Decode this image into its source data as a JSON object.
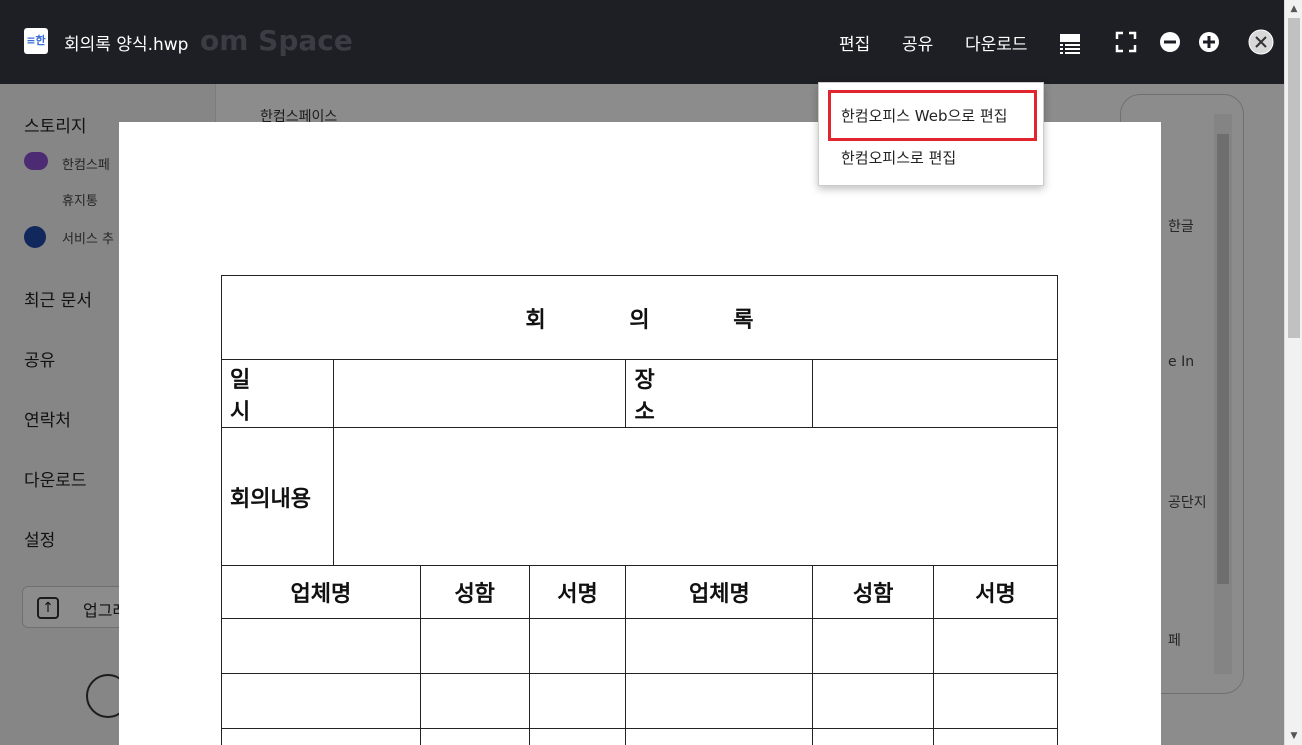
{
  "window": {
    "filename": "회의록 양식.hwp",
    "logo_text": "≡한",
    "ghost_brand": "om Space"
  },
  "toolbar": {
    "edit_label": "편집",
    "share_label": "공유",
    "download_label": "다운로드"
  },
  "edit_menu": {
    "items": [
      {
        "label": "한컴오피스 Web으로 편집",
        "highlighted": true
      },
      {
        "label": "한컴오피스로 편집",
        "highlighted": false
      }
    ],
    "highlight_color": "#e0252f"
  },
  "background": {
    "sidebar": {
      "storage": "스토리지",
      "hancom_space": "한컴스페",
      "trash": "휴지통",
      "add_service": "서비스 추",
      "recent": "최근 문서",
      "share": "공유",
      "contacts": "연락처",
      "download": "다운로드",
      "settings": "설정",
      "upgrade": "업그레"
    },
    "crumb": "한컴스페이스",
    "right_labels": [
      "한글",
      "e In",
      "공단지",
      "페"
    ]
  },
  "document": {
    "title": "회 의 록",
    "row_datetime_label": "일 시",
    "row_place_label": "장 소",
    "row_content_label": "회의내용",
    "columns": [
      "업체명",
      "성함",
      "서명",
      "업체명",
      "성함",
      "서명"
    ]
  }
}
